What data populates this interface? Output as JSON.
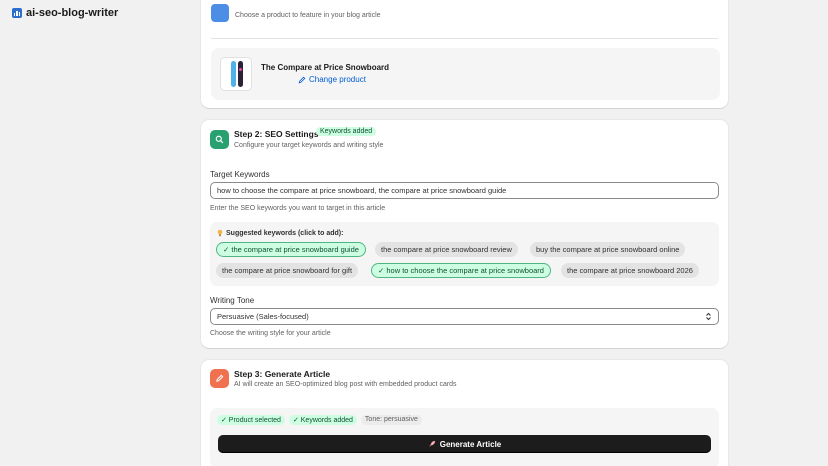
{
  "app": {
    "title": "ai-seo-blog-writer"
  },
  "step1": {
    "subtitle": "Choose a product to feature in your blog article",
    "product_name": "The Compare at Price Snowboard",
    "change_label": "Change product"
  },
  "step2": {
    "title": "Step 2: SEO Settings",
    "badge": "Keywords added",
    "subtitle": "Configure your target keywords and writing style",
    "keywords_label": "Target Keywords",
    "keywords_value": "how to choose the compare at price snowboard, the compare at price snowboard guide",
    "keywords_help": "Enter the SEO keywords you want to target in this article",
    "suggested_title": "Suggested keywords (click to add):",
    "suggestions": [
      {
        "label": "✓ the compare at price snowboard guide",
        "selected": true
      },
      {
        "label": "the compare at price snowboard review",
        "selected": false
      },
      {
        "label": "buy the compare at price snowboard online",
        "selected": false
      },
      {
        "label": "the compare at price snowboard for gift",
        "selected": false
      },
      {
        "label": "✓ how to choose the compare at price snowboard",
        "selected": true
      },
      {
        "label": "the compare at price snowboard 2026",
        "selected": false
      }
    ],
    "tone_label": "Writing Tone",
    "tone_value": "Persuasive (Sales-focused)",
    "tone_help": "Choose the writing style for your article"
  },
  "step3": {
    "title": "Step 3: Generate Article",
    "subtitle": "AI will create an SEO-optimized blog post with embedded product cards",
    "status": [
      "✓ Product selected",
      "✓ Keywords added",
      "Tone: persuasive"
    ],
    "generate_label": "Generate Article"
  },
  "colors": {
    "accent_green": "#29a06f",
    "accent_orange": "#f0714f",
    "primary_button": "#1c1c1c",
    "link": "#005bd3"
  }
}
